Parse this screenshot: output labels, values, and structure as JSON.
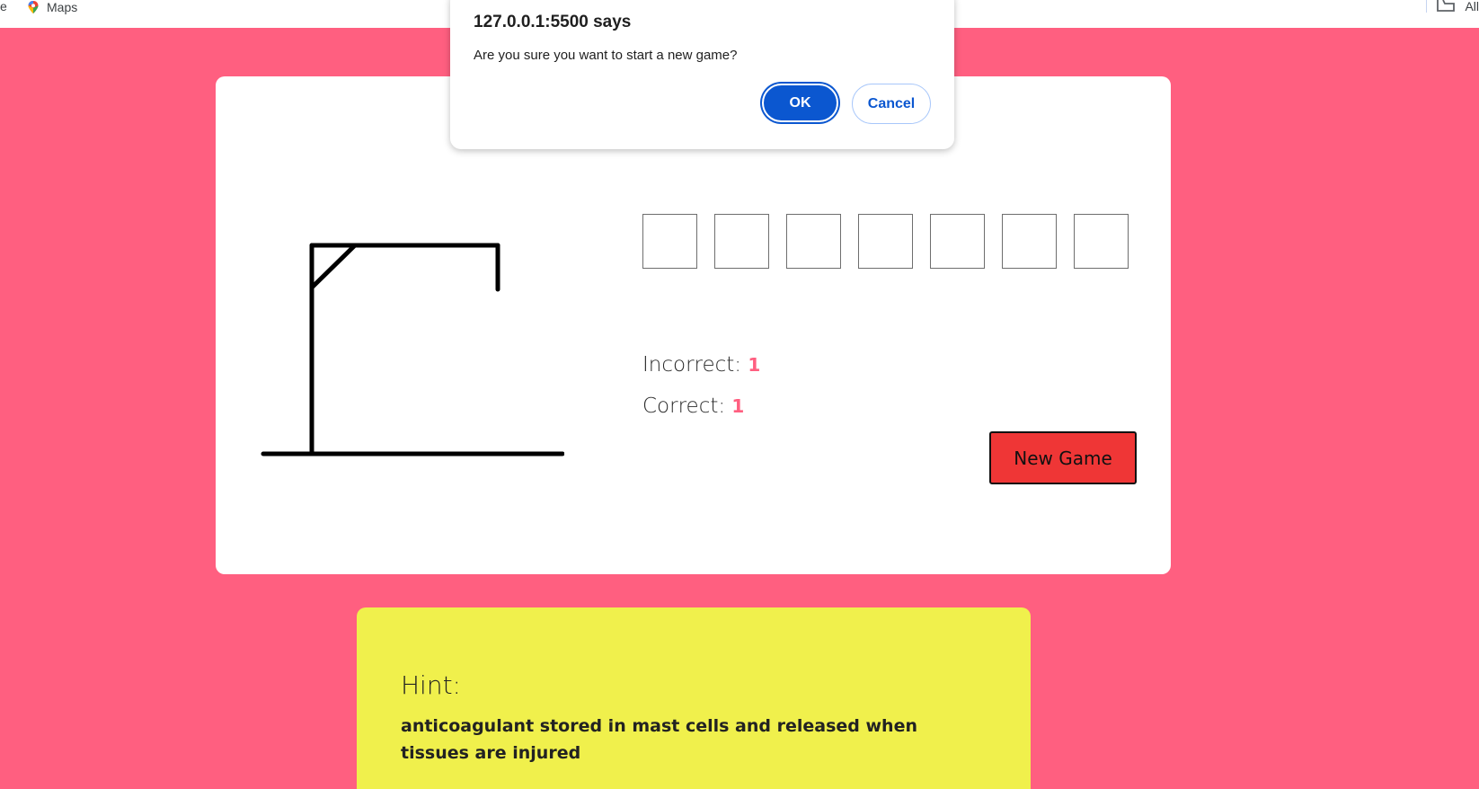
{
  "bookmarks_bar": {
    "partial_left": "e",
    "maps_label": "Maps",
    "all_partial": "All"
  },
  "dialog": {
    "title": "127.0.0.1:5500 says",
    "message": "Are you sure you want to start a new game?",
    "ok_label": "OK",
    "cancel_label": "Cancel"
  },
  "game": {
    "letters": [
      "",
      "",
      "",
      "",
      "",
      "",
      ""
    ],
    "incorrect_label": "Incorrect:",
    "incorrect_value": "1",
    "correct_label": "Correct:",
    "correct_value": "1",
    "new_game_label": "New Game"
  },
  "hint": {
    "title": "Hint:",
    "text": "anticoagulant stored in mast cells and released when tissues are injured"
  },
  "colors": {
    "background": "#ff5f80",
    "hint_background": "#f0f04c",
    "new_game_button": "#ef3636",
    "dialog_primary": "#0b57d0"
  }
}
